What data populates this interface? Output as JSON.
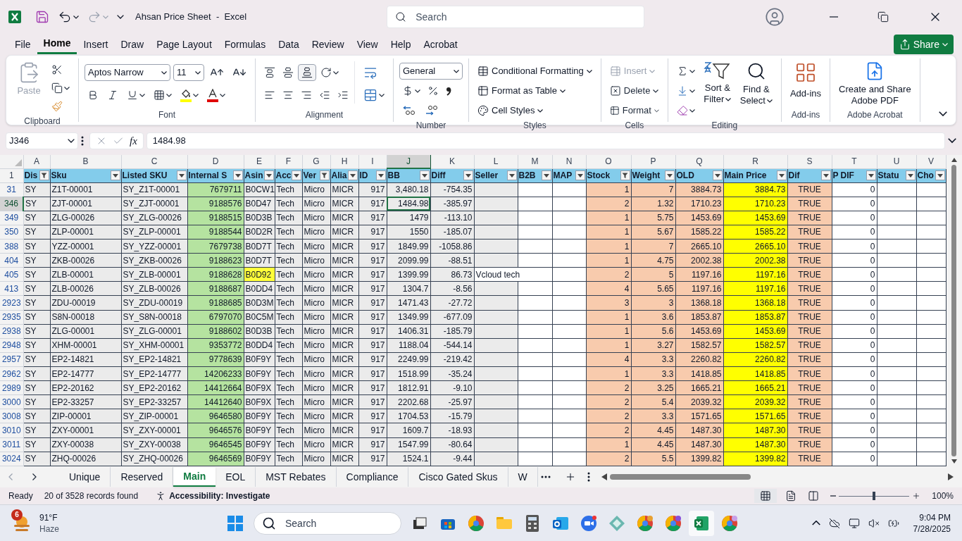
{
  "title_bar": {
    "title": "Ahsan Price Sheet  -  Excel",
    "search_placeholder": "Search",
    "share": "Share"
  },
  "menu_tabs": [
    {
      "label": "File",
      "selected": false
    },
    {
      "label": "Home",
      "selected": true
    },
    {
      "label": "Insert",
      "selected": false
    },
    {
      "label": "Draw",
      "selected": false
    },
    {
      "label": "Page Layout",
      "selected": false
    },
    {
      "label": "Formulas",
      "selected": false
    },
    {
      "label": "Data",
      "selected": false
    },
    {
      "label": "Review",
      "selected": false
    },
    {
      "label": "View",
      "selected": false
    },
    {
      "label": "Help",
      "selected": false
    },
    {
      "label": "Acrobat",
      "selected": false
    }
  ],
  "ribbon": {
    "clipboard": {
      "label": "Clipboard",
      "paste": "Paste"
    },
    "font": {
      "label": "Font",
      "name": "Aptos Narrow",
      "size": "11"
    },
    "alignment": {
      "label": "Alignment"
    },
    "number": {
      "label": "Number",
      "format": "General"
    },
    "styles": {
      "label": "Styles",
      "items": [
        "Conditional Formatting",
        "Format as Table",
        "Cell Styles"
      ]
    },
    "cells": {
      "label": "Cells",
      "items": [
        {
          "label": "Insert",
          "disabled": true
        },
        {
          "label": "Delete",
          "disabled": false
        },
        {
          "label": "Format",
          "disabled": false
        }
      ]
    },
    "editing": {
      "label": "Editing",
      "sort": [
        "Sort &",
        "Filter"
      ],
      "find": [
        "Find &",
        "Select"
      ]
    },
    "addins": {
      "label": "Add-ins",
      "button": "Add-ins"
    },
    "acrobat": {
      "label": "Adobe Acrobat",
      "button": [
        "Create and Share",
        "Adobe PDF"
      ]
    }
  },
  "formula_bar": {
    "name_box": "J346",
    "function_label": "fx",
    "value": "1484.98"
  },
  "columns": [
    {
      "letter": "A",
      "header": "Dis",
      "filtered": true,
      "selected": false
    },
    {
      "letter": "B",
      "header": "Sku",
      "filtered": false,
      "selected": false
    },
    {
      "letter": "C",
      "header": "Listed SKU",
      "filtered": false,
      "selected": false
    },
    {
      "letter": "D",
      "header": "Internal S",
      "filtered": false,
      "selected": false
    },
    {
      "letter": "E",
      "header": "Asin",
      "filtered": false,
      "selected": false
    },
    {
      "letter": "F",
      "header": "Acc",
      "filtered": false,
      "selected": false
    },
    {
      "letter": "G",
      "header": "Ver",
      "filtered": true,
      "selected": false
    },
    {
      "letter": "H",
      "header": "Alia",
      "filtered": false,
      "selected": false
    },
    {
      "letter": "I",
      "header": "ID",
      "filtered": false,
      "selected": false
    },
    {
      "letter": "J",
      "header": "BB",
      "filtered": false,
      "selected": true
    },
    {
      "letter": "K",
      "header": "Diff",
      "filtered": false,
      "selected": false
    },
    {
      "letter": "L",
      "header": "Seller",
      "filtered": false,
      "selected": false
    },
    {
      "letter": "M",
      "header": "B2B",
      "filtered": false,
      "selected": false
    },
    {
      "letter": "N",
      "header": "MAP",
      "filtered": false,
      "selected": false
    },
    {
      "letter": "O",
      "header": "Stock",
      "filtered": true,
      "selected": false
    },
    {
      "letter": "P",
      "header": "Weight",
      "filtered": false,
      "selected": false
    },
    {
      "letter": "Q",
      "header": "OLD",
      "filtered": false,
      "selected": false
    },
    {
      "letter": "R",
      "header": "Main Price",
      "filtered": false,
      "selected": false
    },
    {
      "letter": "S",
      "header": "Dif",
      "filtered": false,
      "selected": false
    },
    {
      "letter": "T",
      "header": "P DIF",
      "filtered": false,
      "selected": false
    },
    {
      "letter": "U",
      "header": "Statu",
      "filtered": false,
      "selected": false
    },
    {
      "letter": "V",
      "header": "Cho",
      "filtered": false,
      "selected": false
    }
  ],
  "header_row_number": "1",
  "rows": [
    {
      "number": "31",
      "selected": false,
      "asin_highlighted": false,
      "cells": {
        "A": "SY",
        "B": "Z1T-00001",
        "C": "SY_Z1T-00001",
        "D": "7679711",
        "E": "B0CW1",
        "F": "Tech",
        "G": "Micro",
        "H": "MICR",
        "I": "917",
        "J": "3,480.18",
        "K": "-754.35",
        "O": "1",
        "P": "7",
        "Q": "3884.73",
        "R": "3884.73",
        "S": "TRUE",
        "T": "0"
      }
    },
    {
      "number": "346",
      "selected": true,
      "asin_highlighted": false,
      "cells": {
        "A": "SY",
        "B": "ZJT-00001",
        "C": "SY_ZJT-00001",
        "D": "9188576",
        "E": "B0D47",
        "F": "Tech",
        "G": "Micro",
        "H": "MICR",
        "I": "917",
        "J": "1484.98",
        "K": "-385.97",
        "O": "2",
        "P": "1.32",
        "Q": "1710.23",
        "R": "1710.23",
        "S": "TRUE",
        "T": "0"
      }
    },
    {
      "number": "349",
      "selected": false,
      "asin_highlighted": false,
      "cells": {
        "A": "SY",
        "B": "ZLG-00026",
        "C": "SY_ZLG-00026",
        "D": "9188515",
        "E": "B0D3B",
        "F": "Tech",
        "G": "Micro",
        "H": "MICR",
        "I": "917",
        "J": "1479",
        "K": "-113.10",
        "O": "1",
        "P": "5.75",
        "Q": "1453.69",
        "R": "1453.69",
        "S": "TRUE",
        "T": "0"
      }
    },
    {
      "number": "350",
      "selected": false,
      "asin_highlighted": false,
      "cells": {
        "A": "SY",
        "B": "ZLP-00001",
        "C": "SY_ZLP-00001",
        "D": "9188544",
        "E": "B0D2R",
        "F": "Tech",
        "G": "Micro",
        "H": "MICR",
        "I": "917",
        "J": "1550",
        "K": "-185.07",
        "O": "1",
        "P": "5.67",
        "Q": "1585.22",
        "R": "1585.22",
        "S": "TRUE",
        "T": "0"
      }
    },
    {
      "number": "388",
      "selected": false,
      "asin_highlighted": false,
      "cells": {
        "A": "SY",
        "B": "YZZ-00001",
        "C": "SY_YZZ-00001",
        "D": "7679738",
        "E": "B0D7T",
        "F": "Tech",
        "G": "Micro",
        "H": "MICR",
        "I": "917",
        "J": "1849.99",
        "K": "-1058.86",
        "O": "1",
        "P": "7",
        "Q": "2665.10",
        "R": "2665.10",
        "S": "TRUE",
        "T": "0"
      }
    },
    {
      "number": "404",
      "selected": false,
      "asin_highlighted": false,
      "cells": {
        "A": "SY",
        "B": "ZKB-00026",
        "C": "SY_ZKB-00026",
        "D": "9188623",
        "E": "B0D7T",
        "F": "Tech",
        "G": "Micro",
        "H": "MICR",
        "I": "917",
        "J": "2099.99",
        "K": "-88.51",
        "O": "1",
        "P": "4.75",
        "Q": "2002.38",
        "R": "2002.38",
        "S": "TRUE",
        "T": "0"
      }
    },
    {
      "number": "405",
      "selected": false,
      "asin_highlighted": true,
      "cells": {
        "A": "SY",
        "B": "ZLB-00001",
        "C": "SY_ZLB-00001",
        "D": "9188628",
        "E": "B0D92",
        "F": "Tech",
        "G": "Micro",
        "H": "MICR",
        "I": "917",
        "J": "1399.99",
        "K": "86.73",
        "L": "Vcloud tech",
        "O": "2",
        "P": "5",
        "Q": "1197.16",
        "R": "1197.16",
        "S": "TRUE",
        "T": "0"
      }
    },
    {
      "number": "413",
      "selected": false,
      "asin_highlighted": false,
      "cells": {
        "A": "SY",
        "B": "ZLB-00026",
        "C": "SY_ZLB-00026",
        "D": "9188687",
        "E": "B0DD4",
        "F": "Tech",
        "G": "Micro",
        "H": "MICR",
        "I": "917",
        "J": "1304.7",
        "K": "-8.56",
        "O": "4",
        "P": "5.65",
        "Q": "1197.16",
        "R": "1197.16",
        "S": "TRUE",
        "T": "0"
      }
    },
    {
      "number": "2923",
      "selected": false,
      "asin_highlighted": false,
      "cells": {
        "A": "SY",
        "B": "ZDU-00019",
        "C": "SY_ZDU-00019",
        "D": "9188685",
        "E": "B0D3M",
        "F": "Tech",
        "G": "Micro",
        "H": "MICR",
        "I": "917",
        "J": "1471.43",
        "K": "-27.72",
        "O": "3",
        "P": "3",
        "Q": "1368.18",
        "R": "1368.18",
        "S": "TRUE",
        "T": "0"
      }
    },
    {
      "number": "2935",
      "selected": false,
      "asin_highlighted": false,
      "cells": {
        "A": "SY",
        "B": "S8N-00018",
        "C": "SY_S8N-00018",
        "D": "6797070",
        "E": "B0C5M",
        "F": "Tech",
        "G": "Micro",
        "H": "MICR",
        "I": "917",
        "J": "1349.99",
        "K": "-677.09",
        "O": "1",
        "P": "3.6",
        "Q": "1853.87",
        "R": "1853.87",
        "S": "TRUE",
        "T": "0"
      }
    },
    {
      "number": "2938",
      "selected": false,
      "asin_highlighted": false,
      "cells": {
        "A": "SY",
        "B": "ZLG-00001",
        "C": "SY_ZLG-00001",
        "D": "9188602",
        "E": "B0D3B",
        "F": "Tech",
        "G": "Micro",
        "H": "MICR",
        "I": "917",
        "J": "1406.31",
        "K": "-185.79",
        "O": "1",
        "P": "5.6",
        "Q": "1453.69",
        "R": "1453.69",
        "S": "TRUE",
        "T": "0"
      }
    },
    {
      "number": "2948",
      "selected": false,
      "asin_highlighted": false,
      "cells": {
        "A": "SY",
        "B": "XHM-00001",
        "C": "SY_XHM-00001",
        "D": "9353772",
        "E": "B0DD4",
        "F": "Tech",
        "G": "Micro",
        "H": "MICR",
        "I": "917",
        "J": "1188.04",
        "K": "-544.14",
        "O": "1",
        "P": "3.27",
        "Q": "1582.57",
        "R": "1582.57",
        "S": "TRUE",
        "T": "0"
      }
    },
    {
      "number": "2957",
      "selected": false,
      "asin_highlighted": false,
      "cells": {
        "A": "SY",
        "B": "EP2-14821",
        "C": "SY_EP2-14821",
        "D": "9778639",
        "E": "B0F9Y",
        "F": "Tech",
        "G": "Micro",
        "H": "MICR",
        "I": "917",
        "J": "2249.99",
        "K": "-219.42",
        "O": "4",
        "P": "3.3",
        "Q": "2260.82",
        "R": "2260.82",
        "S": "TRUE",
        "T": "0"
      }
    },
    {
      "number": "2962",
      "selected": false,
      "asin_highlighted": false,
      "cells": {
        "A": "SY",
        "B": "EP2-14777",
        "C": "SY_EP2-14777",
        "D": "14206233",
        "E": "B0F9Y",
        "F": "Tech",
        "G": "Micro",
        "H": "MICR",
        "I": "917",
        "J": "1518.99",
        "K": "-35.24",
        "O": "1",
        "P": "3.3",
        "Q": "1418.85",
        "R": "1418.85",
        "S": "TRUE",
        "T": "0"
      }
    },
    {
      "number": "2989",
      "selected": false,
      "asin_highlighted": false,
      "cells": {
        "A": "SY",
        "B": "EP2-20162",
        "C": "SY_EP2-20162",
        "D": "14412664",
        "E": "B0F9X",
        "F": "Tech",
        "G": "Micro",
        "H": "MICR",
        "I": "917",
        "J": "1812.91",
        "K": "-9.10",
        "O": "2",
        "P": "3.25",
        "Q": "1665.21",
        "R": "1665.21",
        "S": "TRUE",
        "T": "0"
      }
    },
    {
      "number": "3000",
      "selected": false,
      "asin_highlighted": false,
      "cells": {
        "A": "SY",
        "B": "EP2-33257",
        "C": "SY_EP2-33257",
        "D": "14412640",
        "E": "B0F9X",
        "F": "Tech",
        "G": "Micro",
        "H": "MICR",
        "I": "917",
        "J": "2202.68",
        "K": "-25.97",
        "O": "2",
        "P": "5.4",
        "Q": "2039.32",
        "R": "2039.32",
        "S": "TRUE",
        "T": "0"
      }
    },
    {
      "number": "3008",
      "selected": false,
      "asin_highlighted": false,
      "cells": {
        "A": "SY",
        "B": "ZIP-00001",
        "C": "SY_ZIP-00001",
        "D": "9646580",
        "E": "B0F9Y",
        "F": "Tech",
        "G": "Micro",
        "H": "MICR",
        "I": "917",
        "J": "1704.53",
        "K": "-15.79",
        "O": "2",
        "P": "3.3",
        "Q": "1571.65",
        "R": "1571.65",
        "S": "TRUE",
        "T": "0"
      }
    },
    {
      "number": "3010",
      "selected": false,
      "asin_highlighted": false,
      "cells": {
        "A": "SY",
        "B": "ZXY-00001",
        "C": "SY_ZXY-00001",
        "D": "9646576",
        "E": "B0F9Y",
        "F": "Tech",
        "G": "Micro",
        "H": "MICR",
        "I": "917",
        "J": "1609.7",
        "K": "-18.93",
        "O": "2",
        "P": "4.45",
        "Q": "1487.30",
        "R": "1487.30",
        "S": "TRUE",
        "T": "0"
      }
    },
    {
      "number": "3011",
      "selected": false,
      "asin_highlighted": false,
      "cells": {
        "A": "SY",
        "B": "ZXY-00038",
        "C": "SY_ZXY-00038",
        "D": "9646545",
        "E": "B0F9Y",
        "F": "Tech",
        "G": "Micro",
        "H": "MICR",
        "I": "917",
        "J": "1547.99",
        "K": "-80.64",
        "O": "1",
        "P": "4.45",
        "Q": "1487.30",
        "R": "1487.30",
        "S": "TRUE",
        "T": "0"
      }
    },
    {
      "number": "3024",
      "selected": false,
      "asin_highlighted": false,
      "cells": {
        "A": "SY",
        "B": "ZHQ-00026",
        "C": "SY_ZHQ-00026",
        "D": "9646569",
        "E": "B0F9Y",
        "F": "Tech",
        "G": "Micro",
        "H": "MICR",
        "I": "917",
        "J": "1524.1",
        "K": "-9.44",
        "O": "2",
        "P": "5.5",
        "Q": "1399.82",
        "R": "1399.82",
        "S": "TRUE",
        "T": "0"
      }
    }
  ],
  "sheet_tabs": [
    {
      "label": "Unique",
      "selected": false
    },
    {
      "label": "Reserved",
      "selected": false
    },
    {
      "label": "Main",
      "selected": true
    },
    {
      "label": "EOL",
      "selected": false
    },
    {
      "label": "MST Rebates",
      "selected": false
    },
    {
      "label": "Compliance",
      "selected": false
    },
    {
      "label": "Cisco Gated Skus",
      "selected": false
    },
    {
      "label": "W",
      "selected": false
    }
  ],
  "status_bar": {
    "ready": "Ready",
    "records": "20 of 3528 records found",
    "accessibility": "Accessibility: Investigate",
    "zoom": {
      "level": 0.5,
      "label": "100%"
    }
  },
  "taskbar": {
    "weather": {
      "badge": "6",
      "temperature": "91°F",
      "condition": "Haze"
    },
    "search_placeholder": "Search",
    "time": "9:04 PM",
    "date": "7/28/2025"
  }
}
